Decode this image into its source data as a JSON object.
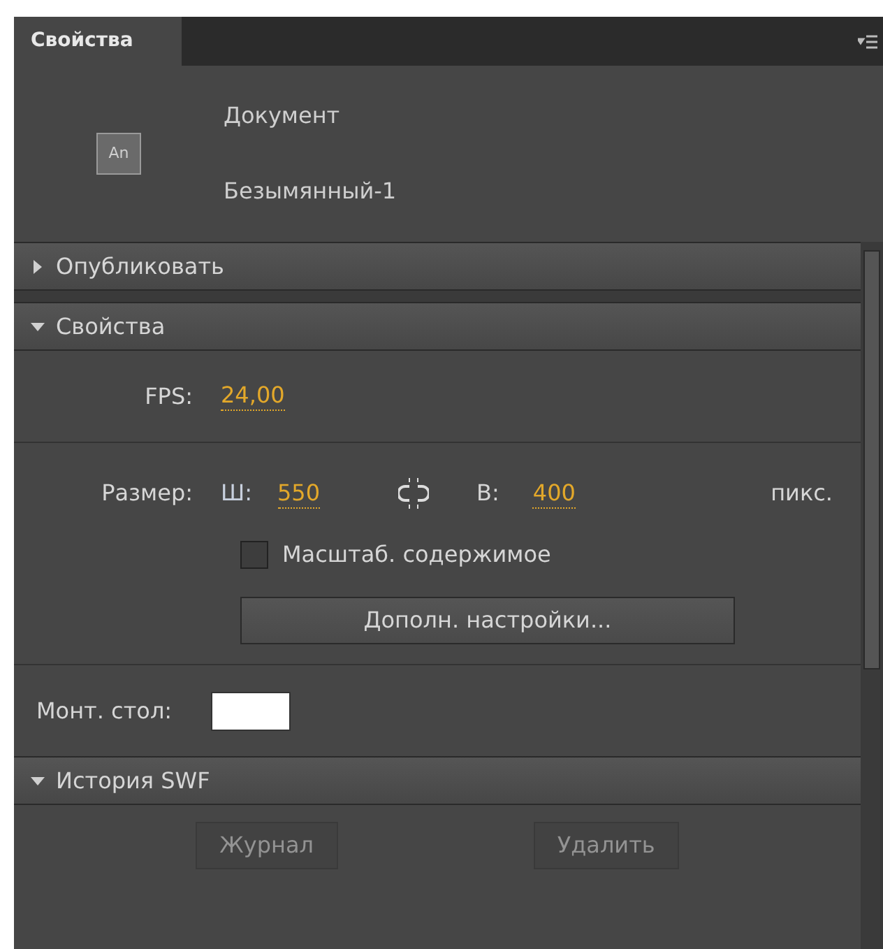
{
  "tab": {
    "label": "Свойства",
    "selected": true
  },
  "document": {
    "icon_label": "An",
    "type": "Документ",
    "name": "Безымянный-1"
  },
  "sections": [
    {
      "title": "Опубликовать",
      "expanded": false
    },
    {
      "title": "Свойства",
      "expanded": true
    },
    {
      "title": "История SWF",
      "expanded": true
    }
  ],
  "properties": {
    "fps_label": "FPS:",
    "fps_value": "24,00",
    "size_label": "Размер:",
    "width_label": "Ш:",
    "width_value": "550",
    "height_label": "В:",
    "height_value": "400",
    "unit": "пикс.",
    "scale_checkbox": {
      "label": "Масштаб. содержимое",
      "checked": false
    },
    "advanced_button": "Дополн. настройки...",
    "stage_label": "Монт. стол:",
    "stage": {
      "color": "#ffffff"
    }
  },
  "history_buttons": [
    {
      "label": "Журнал",
      "disabled": true
    },
    {
      "label": "Удалить",
      "disabled": true
    }
  ]
}
